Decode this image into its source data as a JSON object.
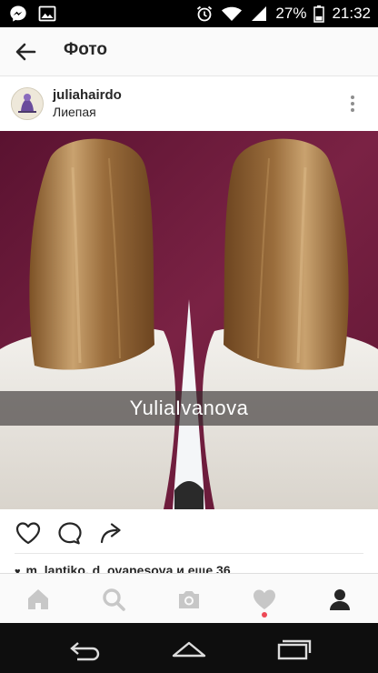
{
  "status_bar": {
    "battery_percent": "27%",
    "time": "21:32",
    "icons": [
      "messenger-icon",
      "image-icon",
      "alarm-icon",
      "wifi-icon",
      "signal-icon",
      "battery-icon"
    ]
  },
  "header": {
    "title": "Фото",
    "back_icon": "arrow-left-icon"
  },
  "post": {
    "username": "juliahairdo",
    "location": "Лиепая",
    "more_icon": "more-vertical-icon",
    "photo_caption": "YuliaIvanova",
    "actions": [
      "heart-icon",
      "comment-icon",
      "share-icon"
    ],
    "likes_text": "m_lantiko, d_ovanesova и еще 36"
  },
  "bottom_nav": {
    "items": [
      "home-icon",
      "search-icon",
      "camera-icon",
      "activity-heart-icon",
      "profile-icon"
    ],
    "active": "profile-icon",
    "notification_color": "#ed4956"
  },
  "system_nav": {
    "buttons": [
      "back-icon",
      "home-icon",
      "recents-icon"
    ]
  },
  "colors": {
    "photo_background": "#6d1a38",
    "hair": "#a77a46",
    "sweater": "#ece8e2"
  }
}
